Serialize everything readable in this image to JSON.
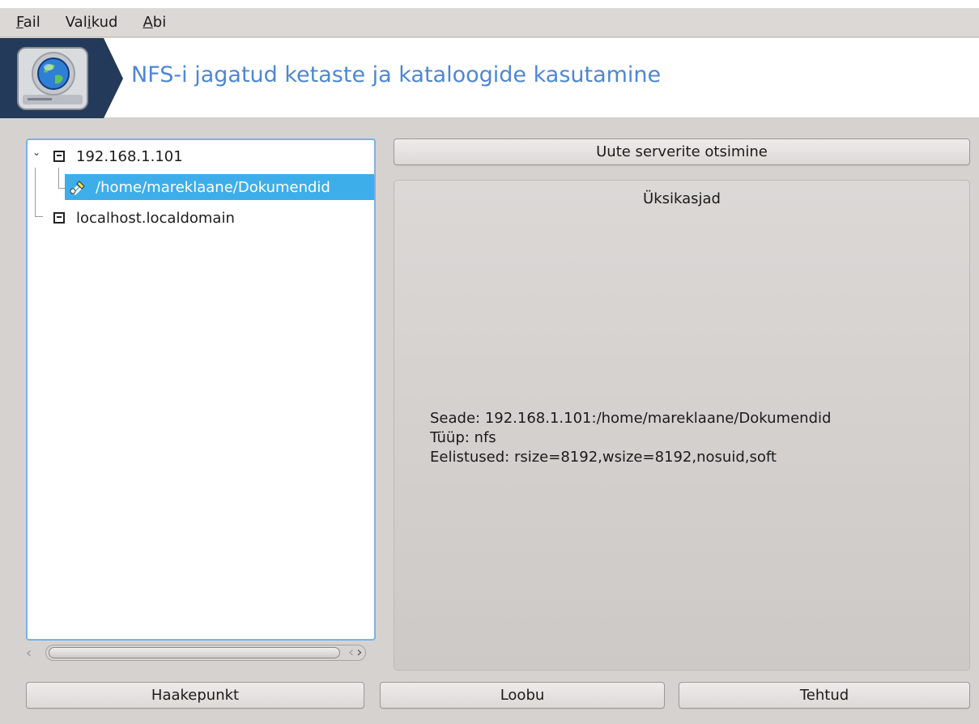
{
  "menubar": {
    "file": {
      "ul": "F",
      "rest": "ail"
    },
    "options": {
      "pre": "Val",
      "ul": "i",
      "rest": "kud"
    },
    "help": {
      "ul": "A",
      "rest": "bi"
    }
  },
  "banner": {
    "title": "NFS-i jagatud ketaste ja kataloogide kasutamine",
    "icon": "network-drive-globe-icon"
  },
  "tree": {
    "items": [
      {
        "label": "192.168.1.101",
        "icon": "computer-icon",
        "expanded": true
      },
      {
        "label": "/home/mareklaane/Dokumendid",
        "icon": "mounted-share-icon",
        "selected": true
      },
      {
        "label": "localhost.localdomain",
        "icon": "computer-icon"
      }
    ]
  },
  "buttons": {
    "search": "Uute serverite otsimine",
    "mountpoint": "Haakepunkt",
    "cancel": "Loobu",
    "done": "Tehtud"
  },
  "details": {
    "title": "Üksikasjad",
    "device": "Seade: 192.168.1.101:/home/mareklaane/Dokumendid",
    "type": "Tüüp: nfs",
    "options": "Eelistused: rsize=8192,wsize=8192,nosuid,soft"
  },
  "colors": {
    "accent": "#3daee9",
    "title": "#4d87d4",
    "banner_dark": "#243a5a"
  }
}
